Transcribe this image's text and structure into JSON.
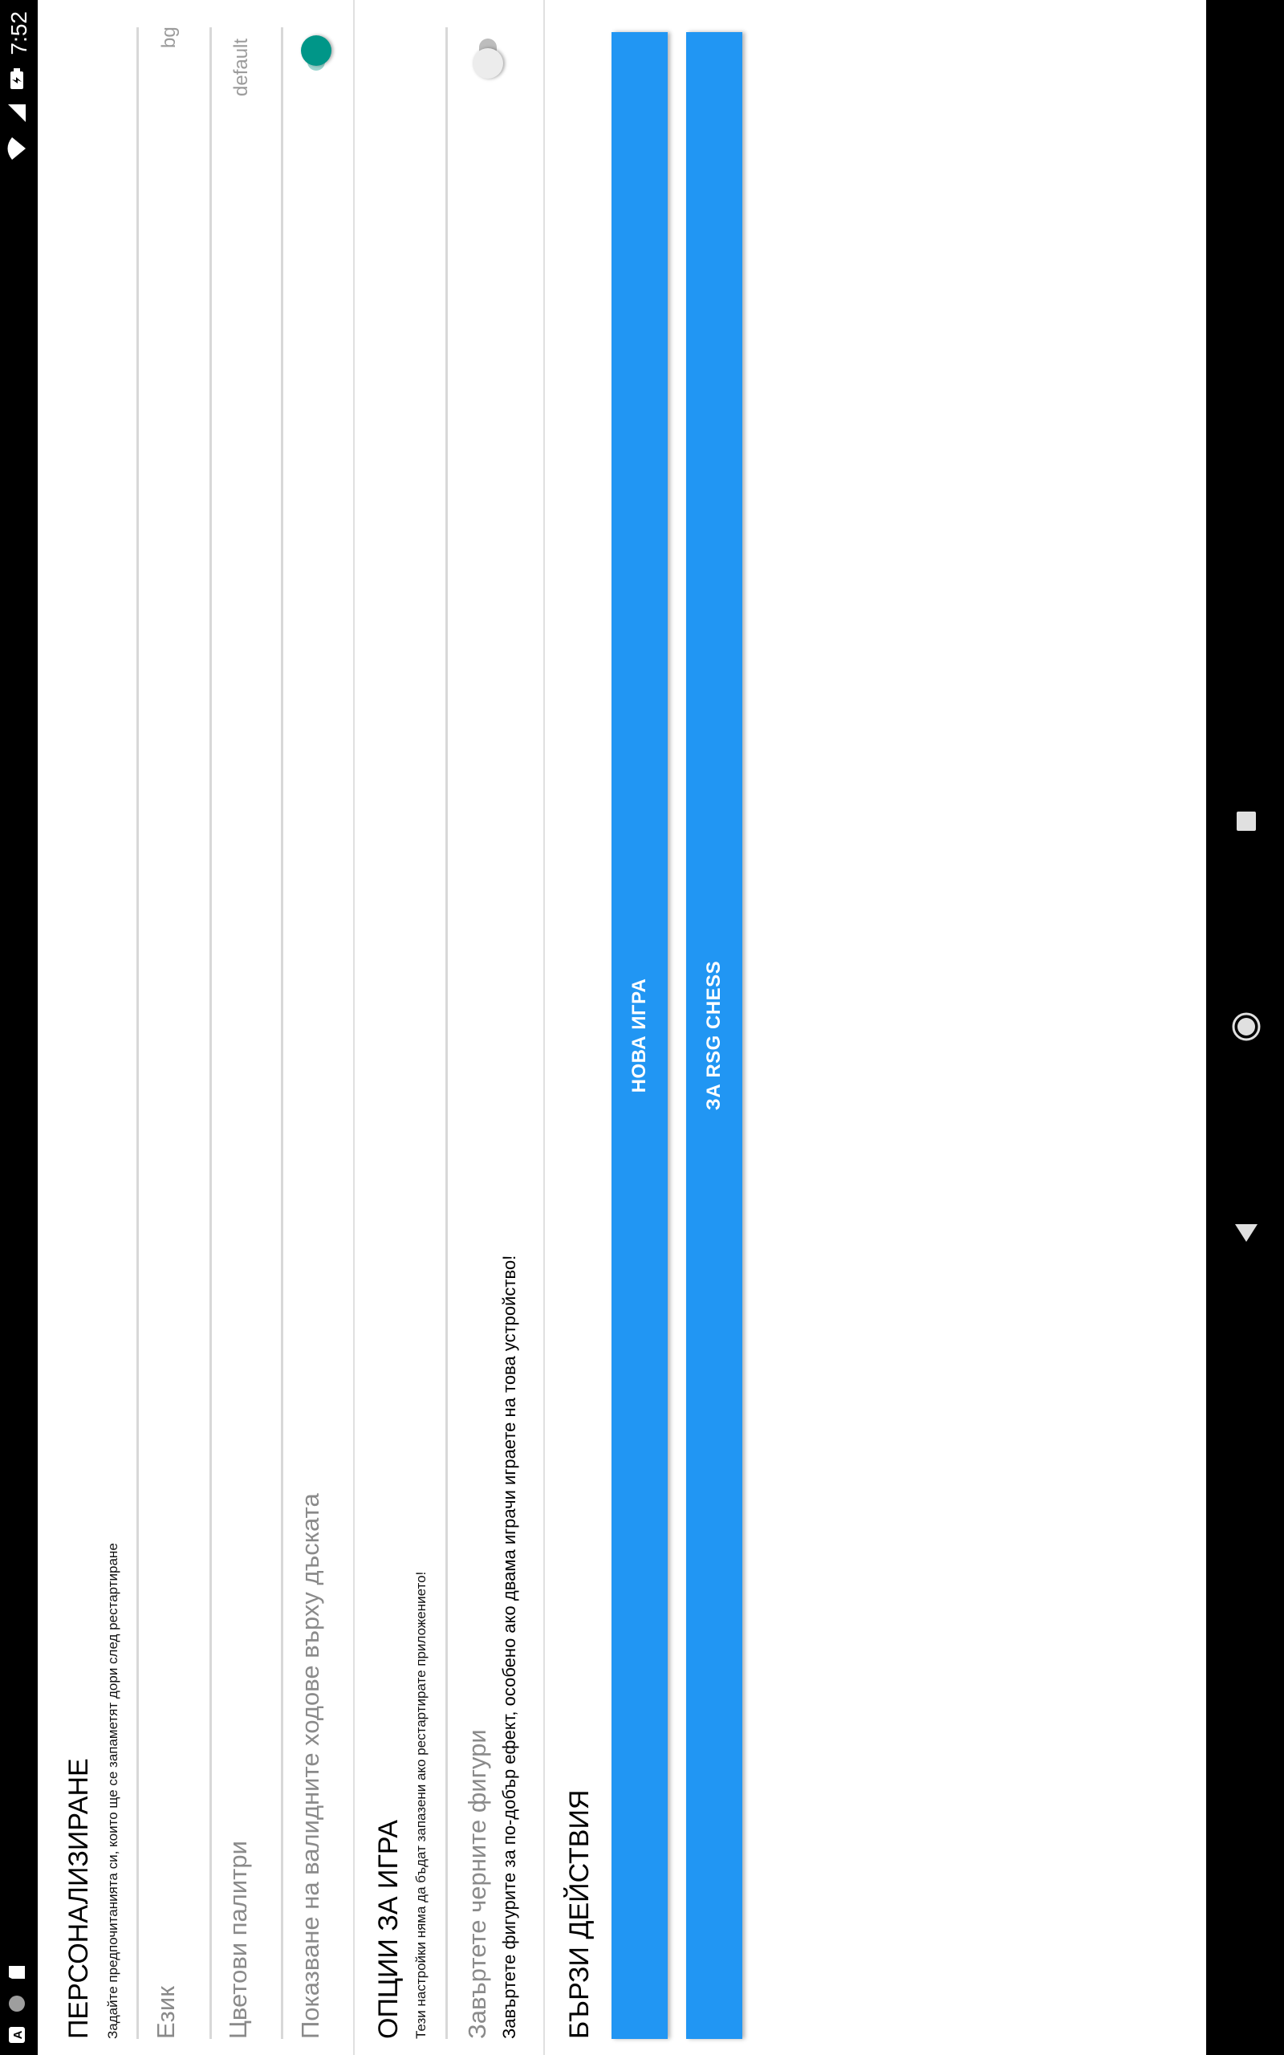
{
  "status_bar": {
    "time": "7:52",
    "icons": [
      "wifi-icon",
      "signal-icon",
      "battery-charging-icon",
      "notification-a-icon",
      "record-icon",
      "sd-card-icon"
    ]
  },
  "nav_bar": {
    "icons": [
      "back-icon",
      "home-icon",
      "recents-icon"
    ]
  },
  "personalization": {
    "title": "ПЕРСОНАЛИЗИРАНЕ",
    "subtitle": "Задайте предпочитанията си, които ще се запаметят дори след рестартиране",
    "language_label": "Език",
    "language_value": "bg",
    "palette_label": "Цветови палитри",
    "palette_value": "default",
    "valid_moves_label": "Показване на валидните ходове върху дъската",
    "valid_moves_on": true
  },
  "game_options": {
    "title": "ОПЦИИ ЗА ИГРА",
    "subtitle": "Тези настройки няма да бъдат запазени ако рестартирате приложението!",
    "rotate_label": "Завъртете черните фигури",
    "rotate_sub": "Завъртете фигурите за по-добър ефект, особено ако двама играчи играете на това устройство!",
    "rotate_on": false
  },
  "quick_actions": {
    "title": "БЪРЗИ ДЕЙСТВИЯ",
    "new_game_label": "НОВА ИГРА",
    "about_label": "ЗА RSG CHESS"
  },
  "colors": {
    "accent": "#009688",
    "button": "#2196f3",
    "switch_off_thumb": "#ececec",
    "switch_off_track": "#bdbdbd"
  }
}
